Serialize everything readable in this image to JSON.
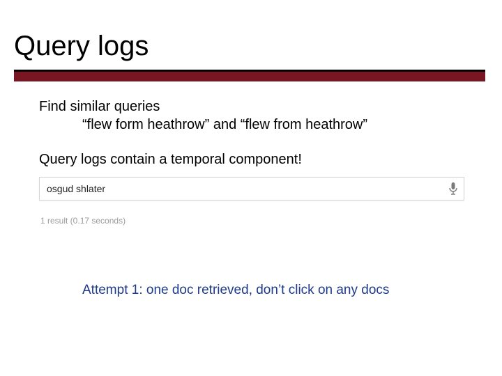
{
  "title": "Query logs",
  "body": {
    "find_line": "Find similar queries",
    "example_line": "“flew form heathrow” and “flew from heathrow”",
    "temporal_line": "Query logs contain a temporal component!"
  },
  "search": {
    "query_text": "osgud shlater",
    "result_count": "1 result (0.17 seconds)",
    "mic_icon": "mic-icon"
  },
  "attempt_caption": "Attempt 1: one doc retrieved, don’t click on any docs",
  "colors": {
    "rule_dark": "#000000",
    "rule_accent": "#7a1621",
    "caption_color": "#1f3a8a"
  }
}
